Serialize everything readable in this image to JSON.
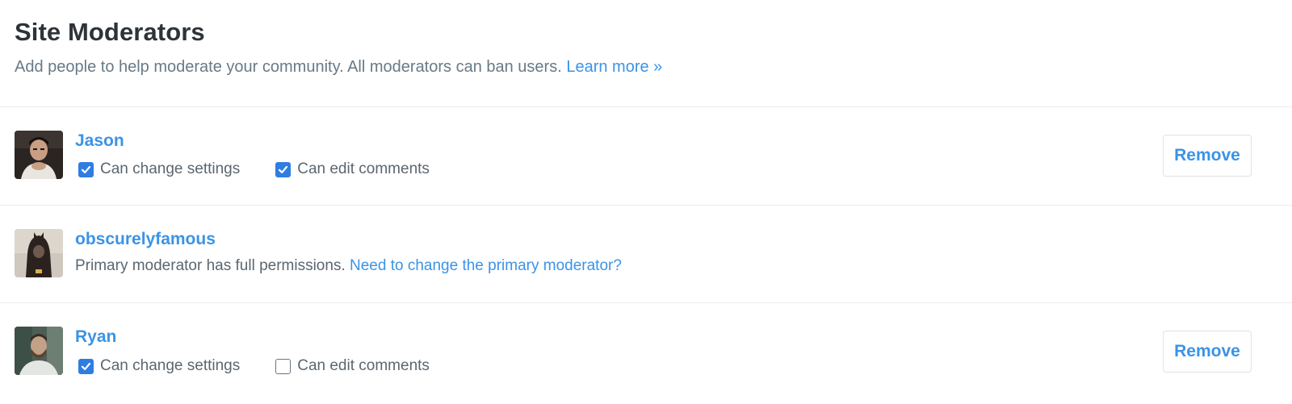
{
  "header": {
    "title": "Site Moderators",
    "subtitle": "Add people to help moderate your community. All moderators can ban users.",
    "learn_more": "Learn more »"
  },
  "colors": {
    "accent": "#3b93e6",
    "checkbox": "#2f7de1",
    "text_muted": "#687a86",
    "title": "#2e3338"
  },
  "moderators": [
    {
      "name": "Jason",
      "avatar_icon": "user-avatar-jason",
      "can_change_settings": {
        "label": "Can change settings",
        "checked": true
      },
      "can_edit_comments": {
        "label": "Can edit comments",
        "checked": true
      },
      "remove_label": "Remove"
    },
    {
      "name": "obscurelyfamous",
      "avatar_icon": "user-avatar-obscurelyfamous",
      "note": "Primary moderator has full permissions.",
      "note_link": "Need to change the primary moderator?"
    },
    {
      "name": "Ryan",
      "avatar_icon": "user-avatar-ryan",
      "can_change_settings": {
        "label": "Can change settings",
        "checked": true
      },
      "can_edit_comments": {
        "label": "Can edit comments",
        "checked": false
      },
      "remove_label": "Remove"
    }
  ]
}
